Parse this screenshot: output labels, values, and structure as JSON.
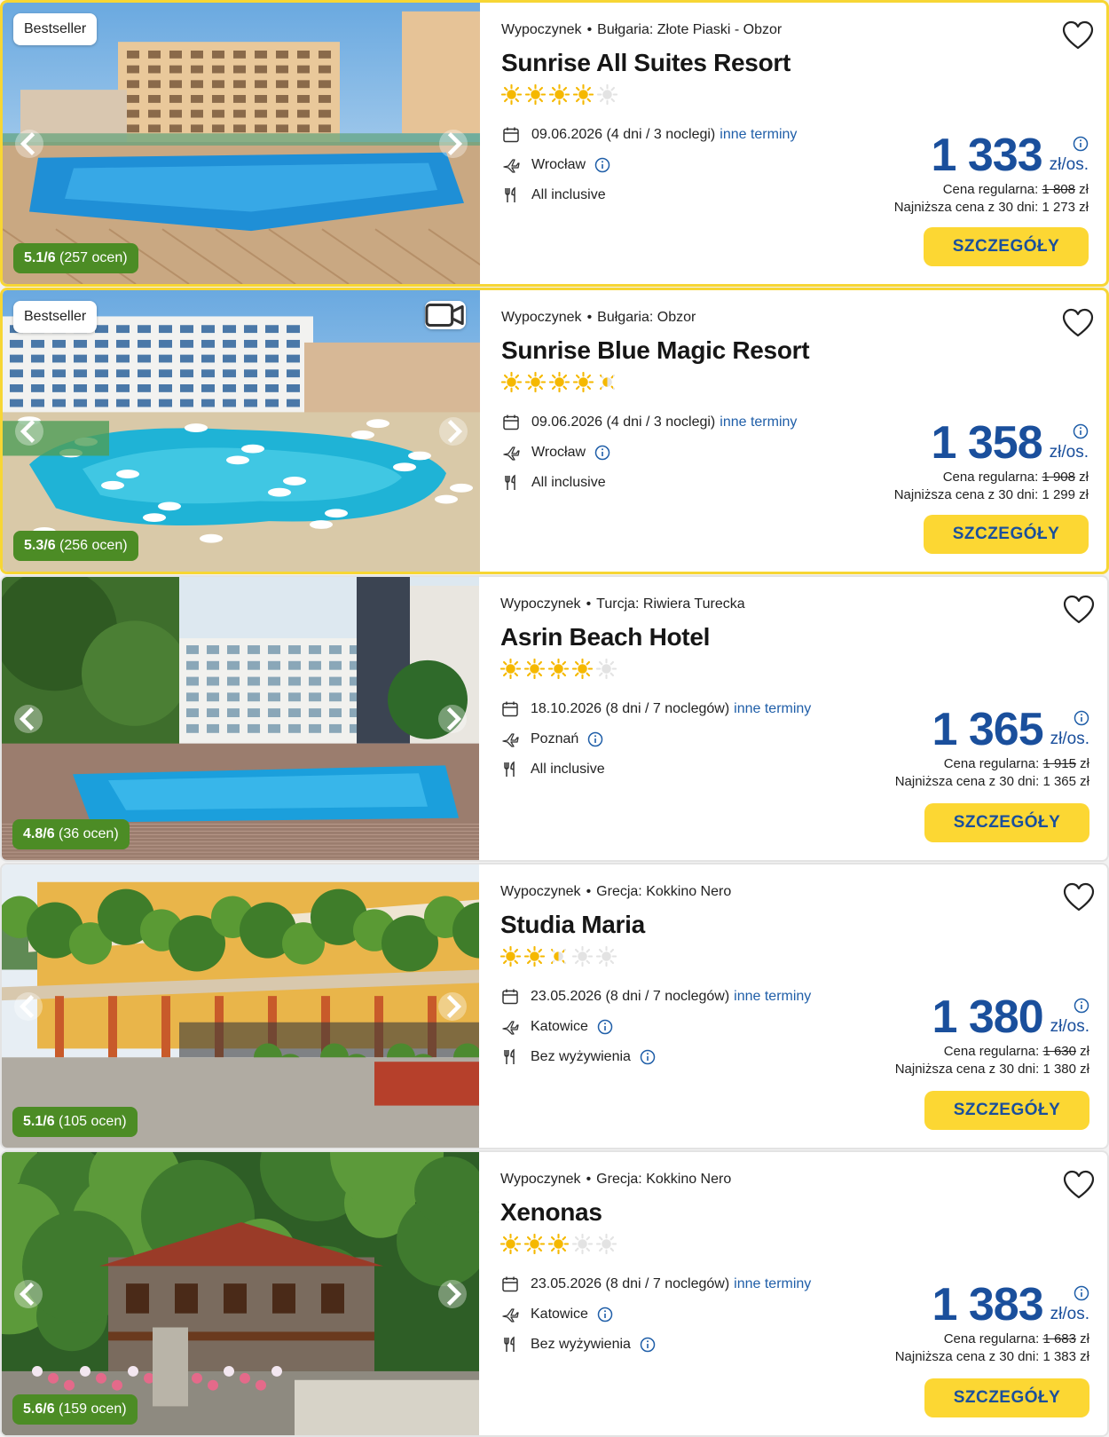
{
  "colors": {
    "accent": "#1a4f9c",
    "button": "#fcd733",
    "rating": "#4c8c25",
    "featured_border": "#f7d634",
    "star": "#f5b800"
  },
  "labels": {
    "details_button": "SZCZEGÓŁY",
    "regular_prefix": "Cena regularna:",
    "lowest_prefix": "Najniższa cena z 30 dni:",
    "other_dates": "inne terminy",
    "price_unit": "zł/os.",
    "currency": "zł"
  },
  "offers": [
    {
      "badge": "Bestseller",
      "video": false,
      "featured": true,
      "rating": "5.1/6",
      "reviews": "(257 ocen)",
      "type": "Wypoczynek",
      "location": "Bułgaria: Złote Piaski - Obzor",
      "name": "Sunrise All Suites Resort",
      "stars": 4,
      "date": "09.06.2026 (4 dni / 3 noclegi)",
      "departure": "Wrocław",
      "board": "All inclusive",
      "board_info": false,
      "price": "1 333",
      "regular_price": "1 808",
      "lowest_price": "1 273 zł",
      "image": "pool-resort"
    },
    {
      "badge": "Bestseller",
      "video": true,
      "featured": true,
      "rating": "5.3/6",
      "reviews": "(256 ocen)",
      "type": "Wypoczynek",
      "location": "Bułgaria: Obzor",
      "name": "Sunrise Blue Magic Resort",
      "stars": 4.5,
      "date": "09.06.2026 (4 dni / 3 noclegi)",
      "departure": "Wrocław",
      "board": "All inclusive",
      "board_info": false,
      "price": "1 358",
      "regular_price": "1 908",
      "lowest_price": "1 299 zł",
      "image": "lagoon-pool"
    },
    {
      "badge": "",
      "video": false,
      "featured": false,
      "rating": "4.8/6",
      "reviews": "(36 ocen)",
      "type": "Wypoczynek",
      "location": "Turcja: Riwiera Turecka",
      "name": "Asrin Beach Hotel",
      "stars": 4,
      "date": "18.10.2026 (8 dni / 7 noclegów)",
      "departure": "Poznań",
      "board": "All inclusive",
      "board_info": false,
      "price": "1 365",
      "regular_price": "1 915",
      "lowest_price": "1 365 zł",
      "image": "hotel-pool"
    },
    {
      "badge": "",
      "video": false,
      "featured": false,
      "rating": "5.1/6",
      "reviews": "(105 ocen)",
      "type": "Wypoczynek",
      "location": "Grecja: Kokkino Nero",
      "name": "Studia Maria",
      "stars": 2.5,
      "date": "23.05.2026 (8 dni / 7 noclegów)",
      "departure": "Katowice",
      "board": "Bez wyżywienia",
      "board_info": true,
      "price": "1 380",
      "regular_price": "1 630",
      "lowest_price": "1 380 zł",
      "image": "yellow-house"
    },
    {
      "badge": "",
      "video": false,
      "featured": false,
      "rating": "5.6/6",
      "reviews": "(159 ocen)",
      "type": "Wypoczynek",
      "location": "Grecja: Kokkino Nero",
      "name": "Xenonas",
      "stars": 3,
      "date": "23.05.2026 (8 dni / 7 noclegów)",
      "departure": "Katowice",
      "board": "Bez wyżywienia",
      "board_info": true,
      "price": "1 383",
      "regular_price": "1 683",
      "lowest_price": "1 383 zł",
      "image": "stone-house"
    }
  ]
}
